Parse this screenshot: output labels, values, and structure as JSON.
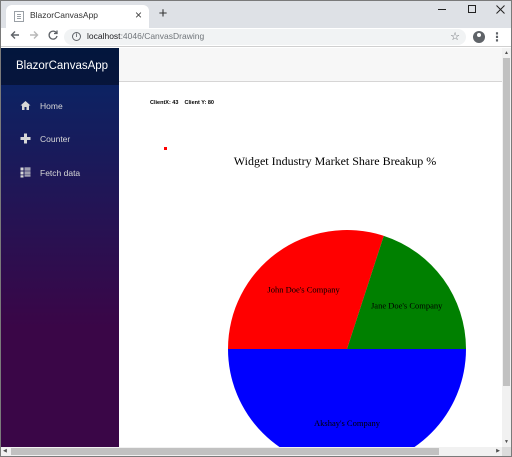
{
  "browser": {
    "tab_title": "BlazorCanvasApp",
    "tab_close": "×",
    "new_tab": "+",
    "url_host": "localhost",
    "url_path": ":4046/CanvasDrawing",
    "star_icon": "☆",
    "menu_icon": "⋮"
  },
  "sidebar": {
    "brand": "BlazorCanvasApp",
    "items": [
      {
        "label": "Home",
        "icon": "home-icon"
      },
      {
        "label": "Counter",
        "icon": "plus-icon"
      },
      {
        "label": "Fetch data",
        "icon": "list-icon"
      }
    ]
  },
  "canvas": {
    "coords_text": "ClientX: 43    Client Y: 80"
  },
  "chart_data": {
    "type": "pie",
    "title": "Widget Industry Market Share Breakup %",
    "slices": [
      {
        "label": "John Doe's Company",
        "value": 30,
        "color": "#ff0000"
      },
      {
        "label": "Jane Doe's Company",
        "value": 20,
        "color": "#008000"
      },
      {
        "label": "Akshay's Company",
        "value": 50,
        "color": "#0000ff"
      }
    ],
    "start": "west, clockwise"
  }
}
